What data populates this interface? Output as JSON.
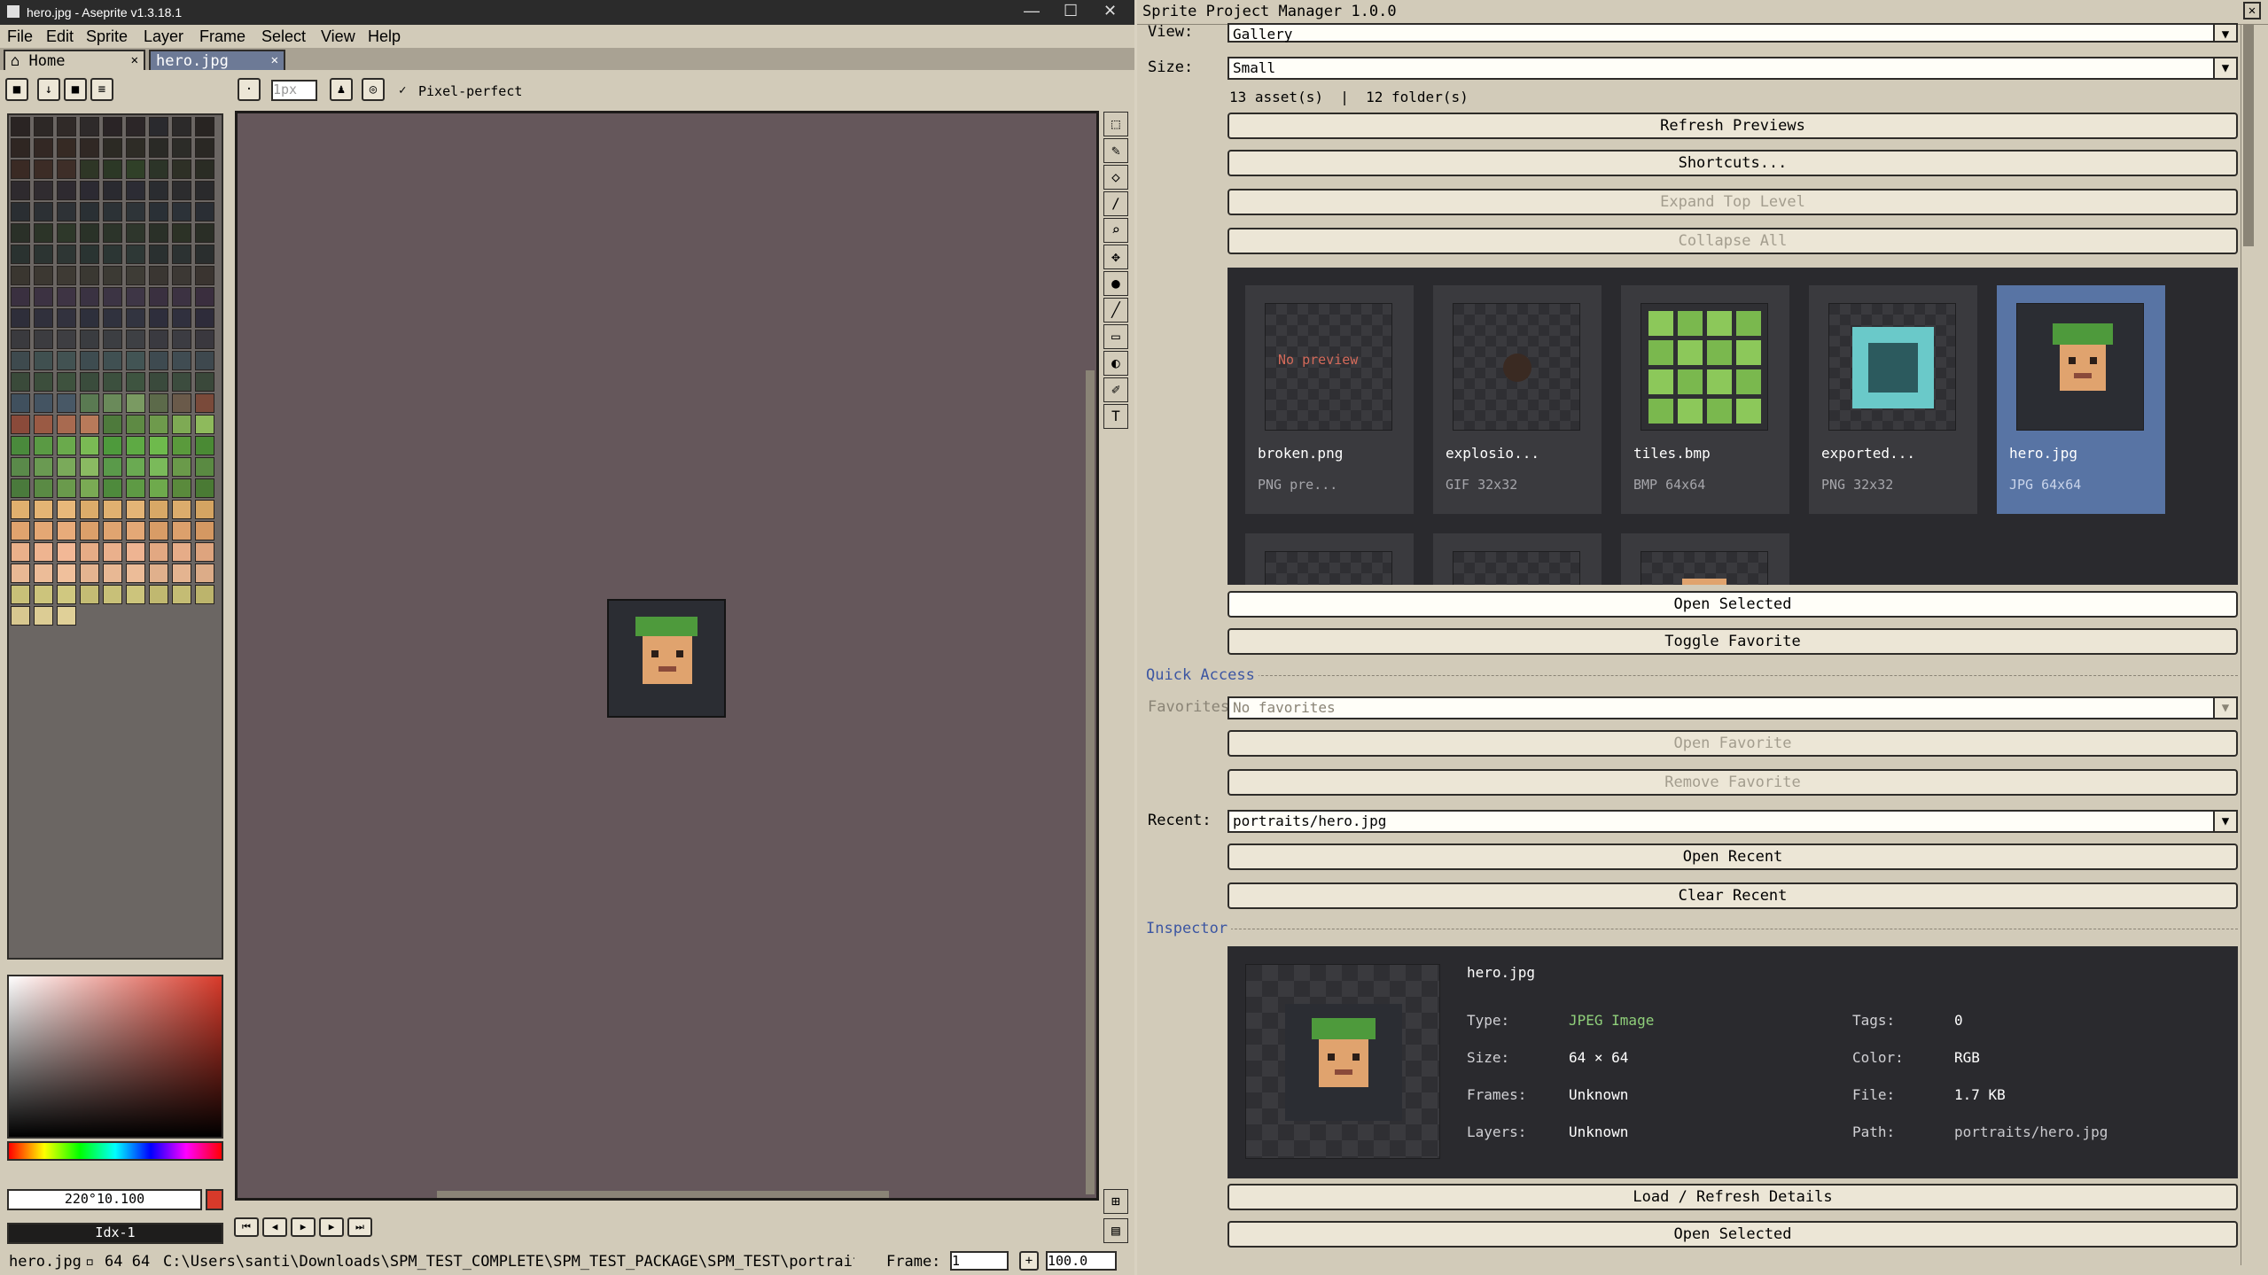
{
  "app": {
    "title": "hero.jpg - Aseprite v1.3.18.1",
    "minimize": "—",
    "maximize": "☐",
    "close": "✕"
  },
  "menu": [
    "File",
    "Edit",
    "Sprite",
    "Layer",
    "Frame",
    "Select",
    "View",
    "Help"
  ],
  "tabs": {
    "home": "Home",
    "file": "hero.jpg",
    "close": "✕"
  },
  "toolbar": {
    "brush_size": "1px",
    "pixel_perfect": "Pixel-perfect"
  },
  "palette": {
    "hex": "220°10.100",
    "index": "Idx-1"
  },
  "status": {
    "file": "hero.jpg",
    "dims": "64 64",
    "path": "C:\\Users\\santi\\Downloads\\SPM_TEST_COMPLETE\\SPM_TEST_PACKAGE\\SPM_TEST\\portraits",
    "frame_label": "Frame:",
    "frame": "1",
    "zoom": "100.0"
  },
  "dialog": {
    "title": "Sprite Project Manager 1.0.0",
    "view_label": "View:",
    "view_value": "Gallery",
    "size_label": "Size:",
    "size_value": "Small",
    "counts": "13 asset(s)  |  12 folder(s)",
    "buttons": {
      "refresh": "Refresh Previews",
      "shortcuts": "Shortcuts...",
      "expand": "Expand Top Level",
      "collapse": "Collapse All",
      "open_selected": "Open Selected",
      "toggle_fav": "Toggle Favorite",
      "open_fav": "Open Favorite",
      "remove_fav": "Remove Favorite",
      "open_recent": "Open Recent",
      "clear_recent": "Clear Recent",
      "load_details": "Load / Refresh Details",
      "open_selected2": "Open Selected"
    },
    "quick_access": "Quick Access",
    "favorites_label": "Favorites:",
    "favorites_value": "No favorites",
    "recent_label": "Recent:",
    "recent_value": "portraits/hero.jpg",
    "inspector_title": "Inspector",
    "gallery": [
      {
        "name": "broken.png",
        "meta": "PNG  pre...",
        "preview": "No preview"
      },
      {
        "name": "explosio...",
        "meta": "GIF  32x32"
      },
      {
        "name": "tiles.bmp",
        "meta": "BMP  64x64"
      },
      {
        "name": "exported...",
        "meta": "PNG  32x32"
      },
      {
        "name": "hero.jpg",
        "meta": "JPG  64x64"
      }
    ],
    "inspector": {
      "name": "hero.jpg",
      "type_k": "Type:",
      "type_v": "JPEG Image",
      "size_k": "Size:",
      "size_v": "64 × 64",
      "frames_k": "Frames:",
      "frames_v": "Unknown",
      "layers_k": "Layers:",
      "layers_v": "Unknown",
      "tags_k": "Tags:",
      "tags_v": "0",
      "color_k": "Color:",
      "color_v": "RGB",
      "file_k": "File:",
      "file_v": "1.7 KB",
      "path_k": "Path:",
      "path_v": "portraits/hero.jpg"
    }
  }
}
